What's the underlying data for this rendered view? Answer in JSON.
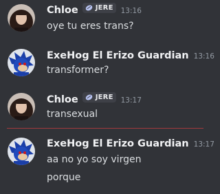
{
  "messages": [
    {
      "username": "Chloe",
      "tag": "JERE",
      "time": "13:16",
      "lines": [
        "oye tu eres trans?"
      ]
    },
    {
      "username": "ExeHog El Erizo Guardian",
      "time": "13:16",
      "lines": [
        "transformer?"
      ]
    },
    {
      "username": "Chloe",
      "tag": "JERE",
      "time": "13:17",
      "lines": [
        "transexual"
      ]
    },
    {
      "username": "ExeHog El Erizo Guardian",
      "time": "13:17",
      "lines": [
        "aa no yo soy virgen",
        "porque"
      ]
    }
  ],
  "icons": {
    "tag": "sparkle-tag-icon",
    "avatar_chloe": "girl-avatar",
    "avatar_exehog": "dark-hedgehog-avatar"
  },
  "colors": {
    "background": "#313338",
    "username": "#f2f3f5",
    "text": "#dbdee1",
    "timestamp": "#949ba4",
    "new_divider": "#a23a3e"
  }
}
